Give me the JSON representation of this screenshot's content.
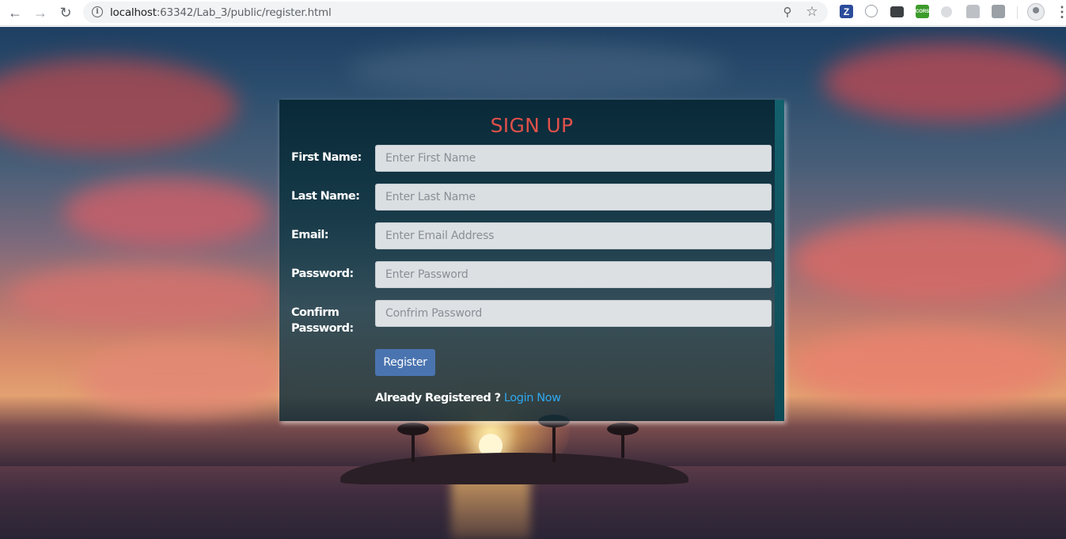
{
  "browser": {
    "url_host": "localhost",
    "url_path": ":63342/Lab_3/public/register.html",
    "info_glyph": "i",
    "ext_z": "Z",
    "ext_cors": "CORS"
  },
  "form": {
    "title": "SIGN UP",
    "first_name_label": "First Name:",
    "first_name_placeholder": "Enter First Name",
    "last_name_label": "Last Name:",
    "last_name_placeholder": "Enter Last Name",
    "email_label": "Email:",
    "email_placeholder": "Enter Email Address",
    "password_label": "Password:",
    "password_placeholder": "Enter Password",
    "confirm_label_line1": "Confirm",
    "confirm_label_line2": "Password:",
    "confirm_placeholder": "Confrim Password",
    "register_button": "Register",
    "already_text": "Already Registered ?",
    "login_link": "Login Now"
  },
  "colors": {
    "title": "#e0504a",
    "button": "#4a74b0",
    "link": "#2ea8f0"
  }
}
